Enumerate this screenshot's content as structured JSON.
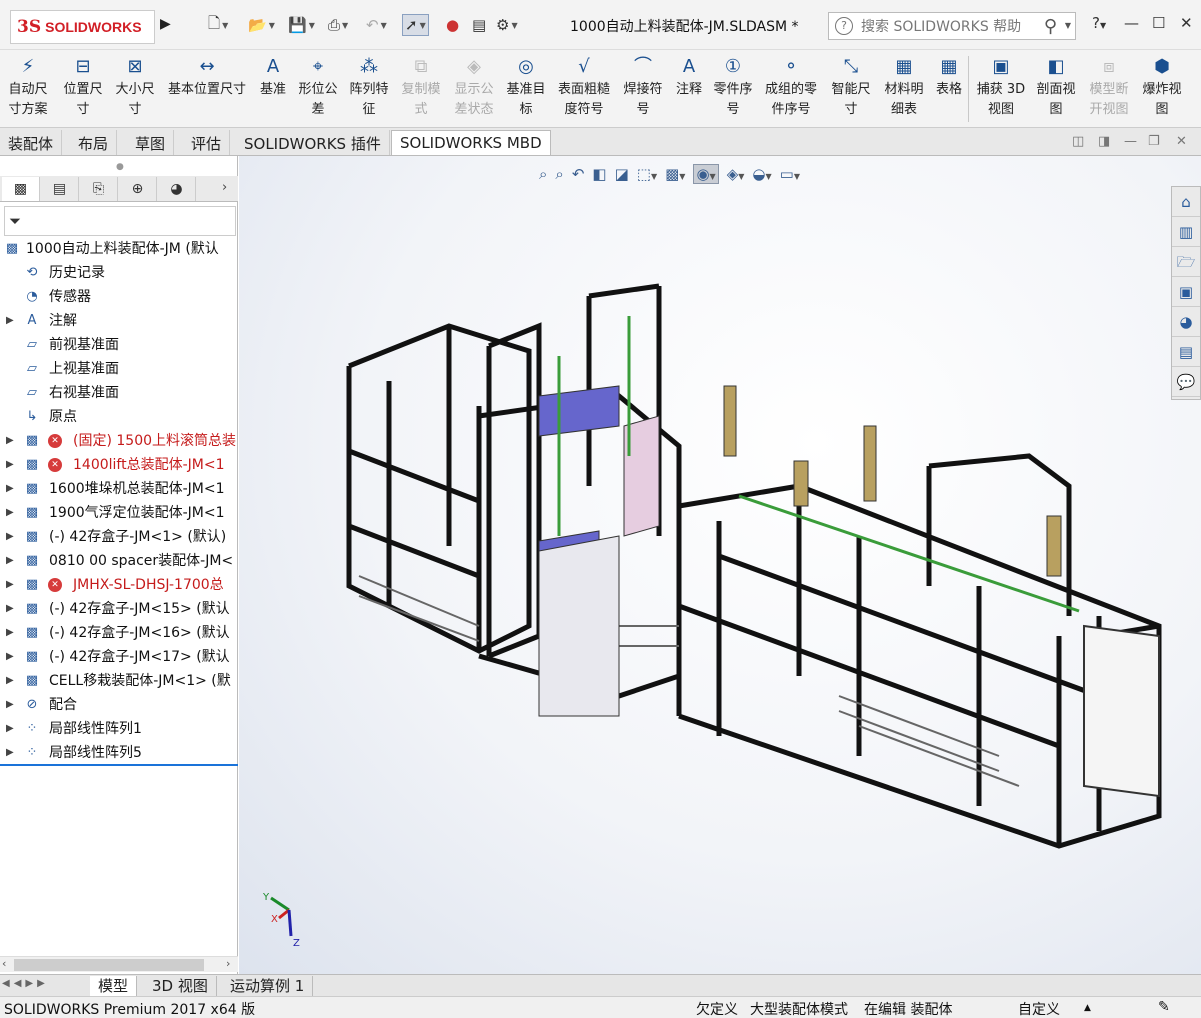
{
  "app": {
    "logo_mark": "3S",
    "logo_text": "SOLIDWORKS",
    "window_title": "1000自动上料装配体-JM.SLDASM *",
    "search_placeholder": "搜索 SOLIDWORKS 帮助",
    "help_label": "?",
    "min_label": "—",
    "max_label": "☐",
    "close_label": "✕"
  },
  "ribbon": {
    "buttons": [
      {
        "label": "自动尺\n寸方案",
        "icon": "auto-dimension-icon",
        "glyph": "⚡",
        "disabled": false
      },
      {
        "label": "位置尺\n寸",
        "icon": "location-dimension-icon",
        "glyph": "⊟",
        "disabled": false
      },
      {
        "label": "大小尺\n寸",
        "icon": "size-dimension-icon",
        "glyph": "⊠",
        "disabled": false
      },
      {
        "label": "基本位置尺寸",
        "icon": "basic-location-dimension-icon",
        "glyph": "↔",
        "disabled": false
      },
      {
        "label": "基准",
        "icon": "datum-icon",
        "glyph": "A",
        "disabled": false
      },
      {
        "label": "形位公\n差",
        "icon": "geometric-tolerance-icon",
        "glyph": "⌖",
        "disabled": false
      },
      {
        "label": "阵列特\n征",
        "icon": "pattern-feature-icon",
        "glyph": "⁂",
        "disabled": false
      },
      {
        "label": "复制模\n式",
        "icon": "copy-scheme-icon",
        "glyph": "⧉",
        "disabled": true
      },
      {
        "label": "显示公\n差状态",
        "icon": "show-tolerance-status-icon",
        "glyph": "◈",
        "disabled": true
      },
      {
        "label": "基准目\n标",
        "icon": "datum-target-icon",
        "glyph": "◎",
        "disabled": false
      },
      {
        "label": "表面粗糙\n度符号",
        "icon": "surface-finish-icon",
        "glyph": "√",
        "disabled": false
      },
      {
        "label": "焊接符\n号",
        "icon": "weld-symbol-icon",
        "glyph": "⌒",
        "disabled": false
      },
      {
        "label": "注释",
        "icon": "note-icon",
        "glyph": "A",
        "disabled": false
      },
      {
        "label": "零件序\n号",
        "icon": "balloon-icon",
        "glyph": "①",
        "disabled": false
      },
      {
        "label": "成组的零\n件序号",
        "icon": "stacked-balloon-icon",
        "glyph": "⚬",
        "disabled": false
      },
      {
        "label": "智能尺\n寸",
        "icon": "smart-dimension-icon",
        "glyph": "⤡",
        "disabled": false
      },
      {
        "label": "材料明\n细表",
        "icon": "bom-icon",
        "glyph": "▦",
        "disabled": false
      },
      {
        "label": "表格",
        "icon": "table-icon",
        "glyph": "▦",
        "disabled": false
      },
      {
        "label": "捕获 3D\n视图",
        "icon": "capture-3d-view-icon",
        "glyph": "▣",
        "disabled": false
      },
      {
        "label": "剖面视\n图",
        "icon": "section-view-icon",
        "glyph": "◧",
        "disabled": false
      },
      {
        "label": "模型断\n开视图",
        "icon": "model-break-view-icon",
        "glyph": "⧈",
        "disabled": true
      },
      {
        "label": "爆炸视\n图",
        "icon": "exploded-view-icon",
        "glyph": "⬢",
        "disabled": false
      }
    ]
  },
  "tabs": [
    "装配体",
    "布局",
    "草图",
    "评估",
    "SOLIDWORKS 插件",
    "SOLIDWORKS MBD"
  ],
  "active_tab": "SOLIDWORKS MBD",
  "tree": {
    "root": "1000自动上料装配体-JM  (默认",
    "nodes": [
      {
        "label": "历史记录",
        "icon": "history-icon",
        "exp": false,
        "err": false,
        "red": false
      },
      {
        "label": "传感器",
        "icon": "sensor-icon",
        "exp": false,
        "err": false,
        "red": false
      },
      {
        "label": "注解",
        "icon": "annotations-icon",
        "exp": true,
        "err": false,
        "red": false
      },
      {
        "label": "前视基准面",
        "icon": "plane-icon",
        "exp": false,
        "err": false,
        "red": false
      },
      {
        "label": "上视基准面",
        "icon": "plane-icon",
        "exp": false,
        "err": false,
        "red": false
      },
      {
        "label": "右视基准面",
        "icon": "plane-icon",
        "exp": false,
        "err": false,
        "red": false
      },
      {
        "label": "原点",
        "icon": "origin-icon",
        "exp": false,
        "err": false,
        "red": false
      },
      {
        "label": "(固定) 1500上料滚筒总装",
        "icon": "assembly-icon",
        "exp": true,
        "err": true,
        "red": true
      },
      {
        "label": "1400lift总装配体-JM<1",
        "icon": "assembly-icon",
        "exp": true,
        "err": true,
        "red": true
      },
      {
        "label": "1600堆垛机总装配体-JM<1",
        "icon": "assembly-icon",
        "exp": true,
        "err": false,
        "red": false
      },
      {
        "label": "1900气浮定位装配体-JM<1",
        "icon": "assembly-icon",
        "exp": true,
        "err": false,
        "red": false
      },
      {
        "label": "(-) 42存盒子-JM<1> (默认)",
        "icon": "assembly-icon",
        "exp": true,
        "err": false,
        "red": false
      },
      {
        "label": "0810 00 spacer装配体-JM<",
        "icon": "assembly-icon",
        "exp": true,
        "err": false,
        "red": false
      },
      {
        "label": "JMHX-SL-DHSJ-1700总",
        "icon": "assembly-icon",
        "exp": true,
        "err": true,
        "red": true
      },
      {
        "label": "(-) 42存盒子-JM<15> (默认",
        "icon": "assembly-icon",
        "exp": true,
        "err": false,
        "red": false
      },
      {
        "label": "(-) 42存盒子-JM<16> (默认",
        "icon": "assembly-icon",
        "exp": true,
        "err": false,
        "red": false
      },
      {
        "label": "(-) 42存盒子-JM<17> (默认",
        "icon": "assembly-icon",
        "exp": true,
        "err": false,
        "red": false
      },
      {
        "label": "CELL移栽装配体-JM<1> (默",
        "icon": "assembly-icon",
        "exp": true,
        "err": false,
        "red": false
      },
      {
        "label": "配合",
        "icon": "mates-icon",
        "exp": true,
        "err": false,
        "red": false
      },
      {
        "label": "局部线性阵列1",
        "icon": "linear-pattern-icon",
        "exp": true,
        "err": false,
        "red": false
      },
      {
        "label": "局部线性阵列5",
        "icon": "linear-pattern-icon",
        "exp": true,
        "err": false,
        "red": false
      }
    ]
  },
  "bottom_tabs": [
    "模型",
    "3D 视图",
    "运动算例 1"
  ],
  "active_bottom_tab": "模型",
  "status": {
    "product": "SOLIDWORKS Premium 2017 x64 版",
    "underdefined": "欠定义",
    "large_assembly": "大型装配体模式",
    "editing": "在编辑 装配体",
    "custom": "自定义",
    "dropdown": "▲"
  },
  "triad": {
    "y": "Y",
    "x": "X",
    "z": "Z"
  },
  "colors": {
    "accent": "#1a73d9",
    "error": "#d63b3b",
    "brand": "#d21f26"
  }
}
